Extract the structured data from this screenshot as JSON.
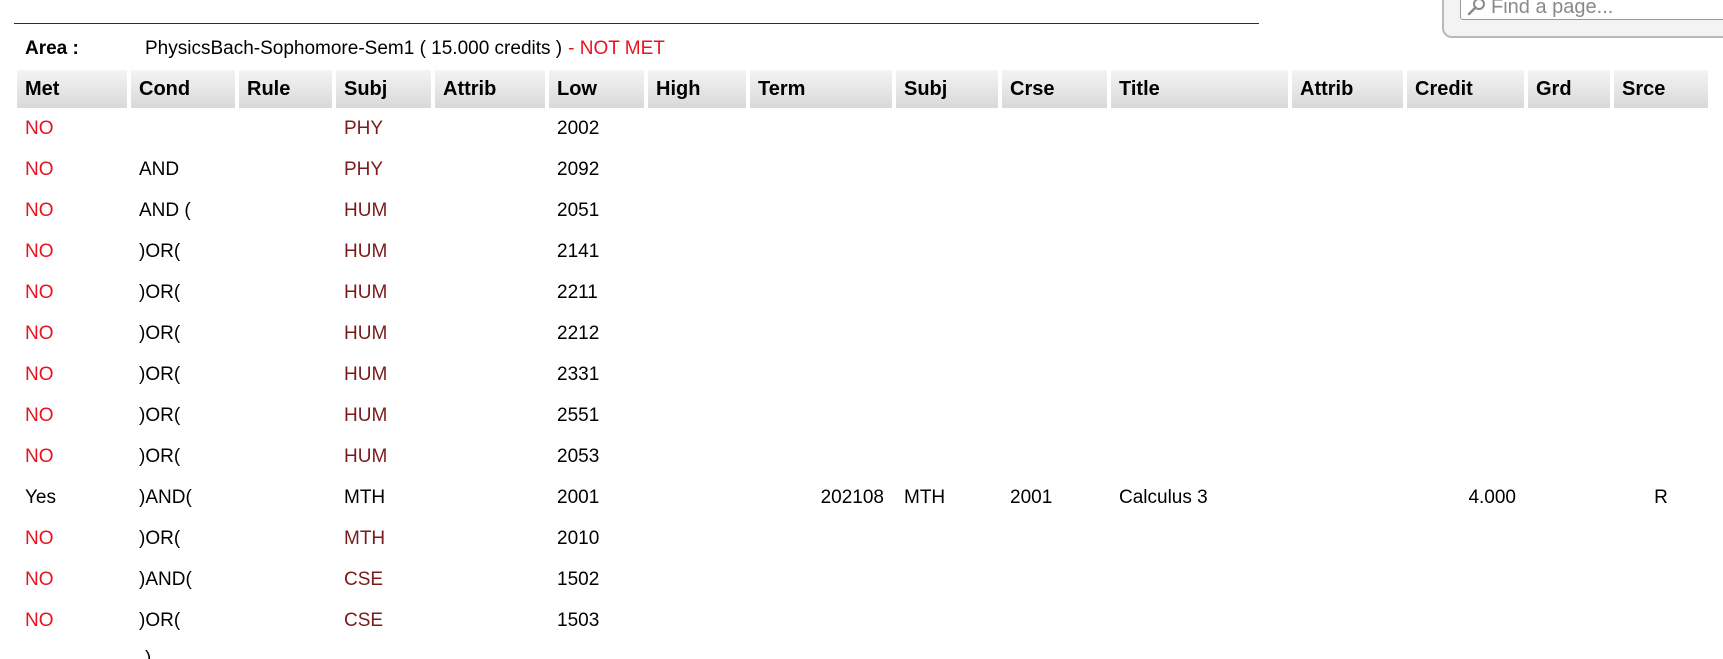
{
  "search": {
    "placeholder": "Find a page..."
  },
  "area": {
    "label": "Area :",
    "name": "PhysicsBach-Sophomore-Sem1 ( 15.000 credits )",
    "status": "- NOT MET"
  },
  "columns": [
    "Met",
    "Cond",
    "Rule",
    "Subj",
    "Attrib",
    "Low",
    "High",
    "Term",
    "Subj",
    "Crse",
    "Title",
    "Attrib",
    "Credit",
    "Grd",
    "Srce"
  ],
  "rows": [
    {
      "met": "NO",
      "cond": "",
      "rule": "",
      "subj": "PHY",
      "attrib": "",
      "low": "2002",
      "high": "",
      "term": "",
      "subj2": "",
      "crse": "",
      "title": "",
      "attrib2": "",
      "credit": "",
      "grd": "",
      "srce": ""
    },
    {
      "met": "NO",
      "cond": "AND",
      "rule": "",
      "subj": "PHY",
      "attrib": "",
      "low": "2092",
      "high": "",
      "term": "",
      "subj2": "",
      "crse": "",
      "title": "",
      "attrib2": "",
      "credit": "",
      "grd": "",
      "srce": ""
    },
    {
      "met": "NO",
      "cond": "AND (",
      "rule": "",
      "subj": "HUM",
      "attrib": "",
      "low": "2051",
      "high": "",
      "term": "",
      "subj2": "",
      "crse": "",
      "title": "",
      "attrib2": "",
      "credit": "",
      "grd": "",
      "srce": ""
    },
    {
      "met": "NO",
      "cond": ")OR(",
      "rule": "",
      "subj": "HUM",
      "attrib": "",
      "low": "2141",
      "high": "",
      "term": "",
      "subj2": "",
      "crse": "",
      "title": "",
      "attrib2": "",
      "credit": "",
      "grd": "",
      "srce": ""
    },
    {
      "met": "NO",
      "cond": ")OR(",
      "rule": "",
      "subj": "HUM",
      "attrib": "",
      "low": "2211",
      "high": "",
      "term": "",
      "subj2": "",
      "crse": "",
      "title": "",
      "attrib2": "",
      "credit": "",
      "grd": "",
      "srce": ""
    },
    {
      "met": "NO",
      "cond": ")OR(",
      "rule": "",
      "subj": "HUM",
      "attrib": "",
      "low": "2212",
      "high": "",
      "term": "",
      "subj2": "",
      "crse": "",
      "title": "",
      "attrib2": "",
      "credit": "",
      "grd": "",
      "srce": ""
    },
    {
      "met": "NO",
      "cond": ")OR(",
      "rule": "",
      "subj": "HUM",
      "attrib": "",
      "low": "2331",
      "high": "",
      "term": "",
      "subj2": "",
      "crse": "",
      "title": "",
      "attrib2": "",
      "credit": "",
      "grd": "",
      "srce": ""
    },
    {
      "met": "NO",
      "cond": ")OR(",
      "rule": "",
      "subj": "HUM",
      "attrib": "",
      "low": "2551",
      "high": "",
      "term": "",
      "subj2": "",
      "crse": "",
      "title": "",
      "attrib2": "",
      "credit": "",
      "grd": "",
      "srce": ""
    },
    {
      "met": "NO",
      "cond": ")OR(",
      "rule": "",
      "subj": "HUM",
      "attrib": "",
      "low": "2053",
      "high": "",
      "term": "",
      "subj2": "",
      "crse": "",
      "title": "",
      "attrib2": "",
      "credit": "",
      "grd": "",
      "srce": ""
    },
    {
      "met": "Yes",
      "cond": ")AND(",
      "rule": "",
      "subj": "MTH",
      "attrib": "",
      "low": "2001",
      "high": "",
      "term": "202108",
      "subj2": "MTH",
      "crse": "2001",
      "title": "Calculus 3",
      "attrib2": "",
      "credit": "4.000",
      "grd": "",
      "srce": "R"
    },
    {
      "met": "NO",
      "cond": ")OR(",
      "rule": "",
      "subj": "MTH",
      "attrib": "",
      "low": "2010",
      "high": "",
      "term": "",
      "subj2": "",
      "crse": "",
      "title": "",
      "attrib2": "",
      "credit": "",
      "grd": "",
      "srce": ""
    },
    {
      "met": "NO",
      "cond": ")AND(",
      "rule": "",
      "subj": "CSE",
      "attrib": "",
      "low": "1502",
      "high": "",
      "term": "",
      "subj2": "",
      "crse": "",
      "title": "",
      "attrib2": "",
      "credit": "",
      "grd": "",
      "srce": ""
    },
    {
      "met": "NO",
      "cond": ")OR(",
      "rule": "",
      "subj": "CSE",
      "attrib": "",
      "low": "1503",
      "high": "",
      "term": "",
      "subj2": "",
      "crse": "",
      "title": "",
      "attrib2": "",
      "credit": "",
      "grd": "",
      "srce": ""
    }
  ],
  "partial_row_cond": ")",
  "colors": {
    "not_met": "#e8131e",
    "subj_unmet": "#7a1b1b",
    "rule_line": "#1a1acc",
    "header_bg": "#dcdcdc"
  }
}
